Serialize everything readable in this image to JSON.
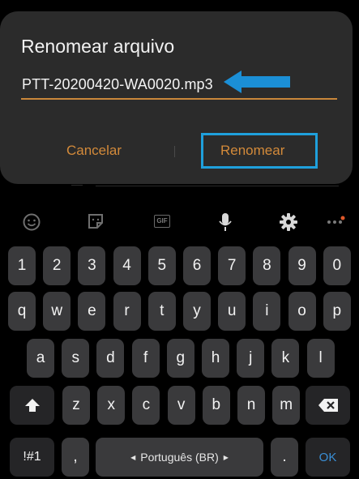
{
  "dialog": {
    "title": "Renomear arquivo",
    "filename_value": "PTT-20200420-WA0020.mp3",
    "cancel_label": "Cancelar",
    "rename_label": "Renomear"
  },
  "toolbar": {
    "gif_label": "GIF",
    "icons": [
      "emoji-icon",
      "sticker-icon",
      "gif-icon",
      "microphone-icon",
      "settings-gear-icon",
      "more-options-icon"
    ]
  },
  "keyboard": {
    "row1": [
      "1",
      "2",
      "3",
      "4",
      "5",
      "6",
      "7",
      "8",
      "9",
      "0"
    ],
    "row2": [
      "q",
      "w",
      "e",
      "r",
      "t",
      "y",
      "u",
      "i",
      "o",
      "p"
    ],
    "row3": [
      "a",
      "s",
      "d",
      "f",
      "g",
      "h",
      "j",
      "k",
      "l"
    ],
    "row4": [
      "z",
      "x",
      "c",
      "v",
      "b",
      "n",
      "m"
    ],
    "symbols_label": "!#1",
    "comma_label": ",",
    "space_label": "Português (BR)",
    "period_label": ".",
    "ok_label": "OK"
  },
  "colors": {
    "dialog_bg": "#2b2b2b",
    "accent_orange": "#d38a3a",
    "highlight_blue": "#1fa0dc",
    "key_bg": "#3a3a3c",
    "ok_blue": "#3a8fd6"
  }
}
